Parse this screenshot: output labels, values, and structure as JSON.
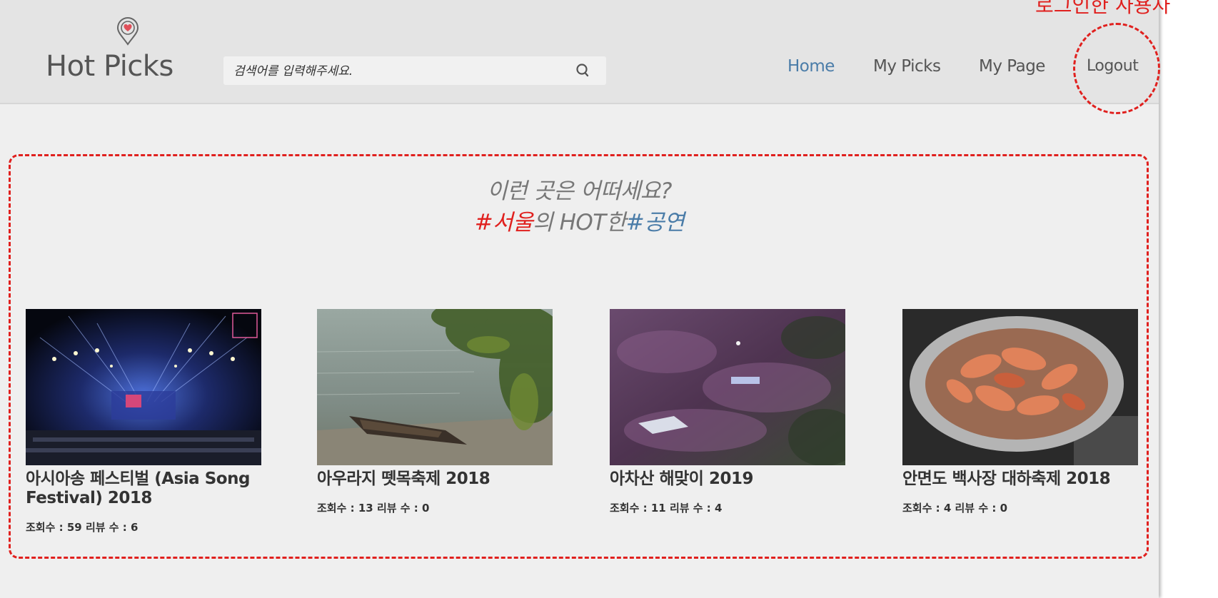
{
  "header": {
    "logo_text": "Hot Picks",
    "search": {
      "placeholder": "검색어를 입력해주세요.",
      "value": ""
    },
    "nav": {
      "home": "Home",
      "my_picks": "My Picks",
      "my_page": "My Page",
      "logout": "Logout"
    }
  },
  "annotation": {
    "label": "로그인한 사용자",
    "color": "#e0201e"
  },
  "recommend": {
    "line1": "이런 곳은 어떠세요?",
    "tag1": "#서울",
    "mid": "의 HOT한",
    "tag2": "#공연"
  },
  "cards": [
    {
      "title": "아시아송 페스티벌 (Asia Song Festival) 2018",
      "stats": "조회수 : 59 리뷰 수 : 6"
    },
    {
      "title": "아우라지 뗏목축제 2018",
      "stats": "조회수 : 13 리뷰 수 : 0"
    },
    {
      "title": "아차산 해맞이 2019",
      "stats": "조회수 : 11 리뷰 수 : 4"
    },
    {
      "title": "안면도 백사장 대하축제 2018",
      "stats": "조회수 : 4 리뷰 수 : 0"
    }
  ],
  "colors": {
    "accent_blue": "#4a7ca8",
    "accent_red": "#e0201e",
    "text": "#555555"
  }
}
